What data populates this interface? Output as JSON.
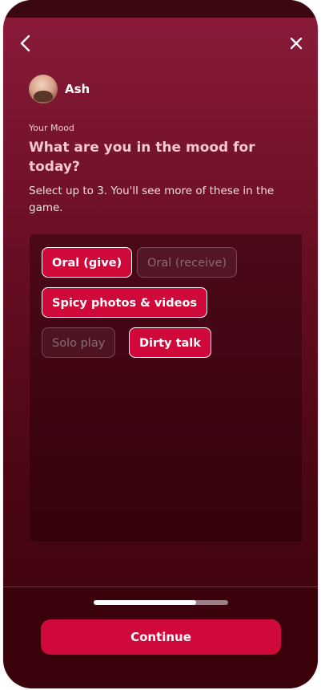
{
  "profile": {
    "name": "Ash"
  },
  "header": {
    "eyebrow": "Your Mood",
    "title": "What are you in the mood for today?",
    "subtitle": "Select up to 3. You'll see more of these in the game."
  },
  "options": [
    {
      "label": "Oral (give)",
      "selected": true
    },
    {
      "label": "Oral (receive)",
      "selected": false
    },
    {
      "label": "Spicy photos & videos",
      "selected": true
    },
    {
      "label": "Solo play",
      "selected": false
    },
    {
      "label": "Dirty talk",
      "selected": true
    }
  ],
  "progress": {
    "fraction": 0.76
  },
  "footer": {
    "continue_label": "Continue"
  },
  "colors": {
    "accent": "#cf0a3a",
    "background_top": "#8b1b3a",
    "background_bottom": "#3a040c"
  },
  "icons": {
    "back": "chevron-left-icon",
    "close": "close-icon"
  }
}
